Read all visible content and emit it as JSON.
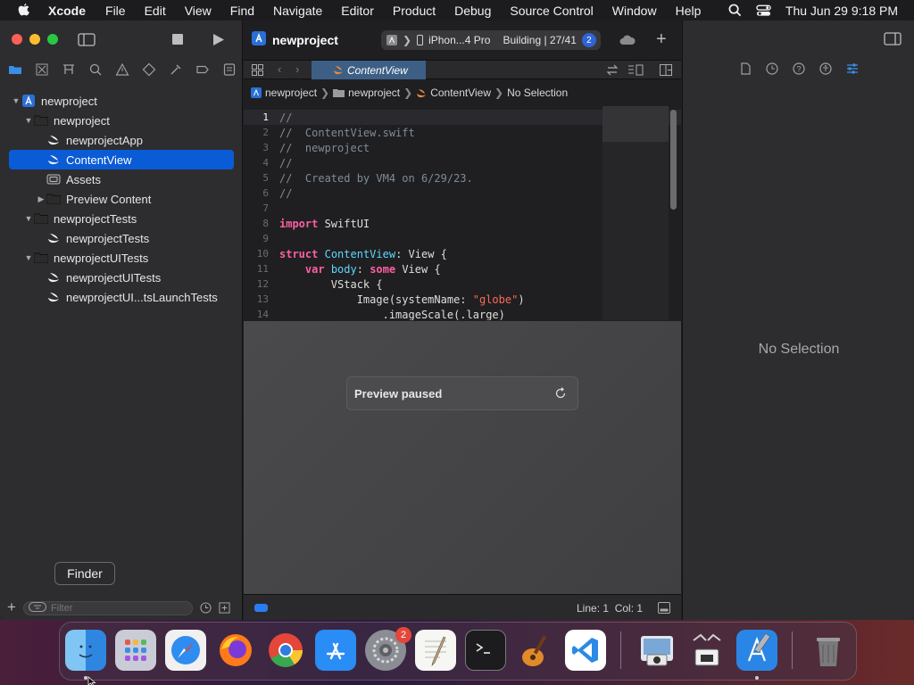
{
  "menubar": {
    "app": "Xcode",
    "items": [
      "File",
      "Edit",
      "View",
      "Find",
      "Navigate",
      "Editor",
      "Product",
      "Debug",
      "Source Control",
      "Window",
      "Help"
    ],
    "datetime": "Thu Jun 29  9:18 PM"
  },
  "toolbar": {
    "project": "newproject",
    "device": "iPhon...4 Pro",
    "status": "Building | 27/41",
    "badge": "2"
  },
  "navigator": {
    "tree": [
      {
        "label": "newproject",
        "level": 0,
        "disclosure": "open",
        "icon": "xcodeproj-icon"
      },
      {
        "label": "newproject",
        "level": 1,
        "disclosure": "open",
        "icon": "folder-icon"
      },
      {
        "label": "newprojectApp",
        "level": 2,
        "disclosure": "",
        "icon": "swift-file-icon"
      },
      {
        "label": "ContentView",
        "level": 2,
        "disclosure": "",
        "icon": "swift-file-icon",
        "selected": true
      },
      {
        "label": "Assets",
        "level": 2,
        "disclosure": "",
        "icon": "assets-icon"
      },
      {
        "label": "Preview Content",
        "level": 2,
        "disclosure": "closed",
        "icon": "folder-icon"
      },
      {
        "label": "newprojectTests",
        "level": 1,
        "disclosure": "open",
        "icon": "folder-icon"
      },
      {
        "label": "newprojectTests",
        "level": 2,
        "disclosure": "",
        "icon": "swift-file-icon"
      },
      {
        "label": "newprojectUITests",
        "level": 1,
        "disclosure": "open",
        "icon": "folder-icon"
      },
      {
        "label": "newprojectUITests",
        "level": 2,
        "disclosure": "",
        "icon": "swift-file-icon"
      },
      {
        "label": "newprojectUI...tsLaunchTests",
        "level": 2,
        "disclosure": "",
        "icon": "swift-file-icon"
      }
    ],
    "filter_placeholder": "Filter"
  },
  "tooltip": "Finder",
  "editor": {
    "tab": "ContentView",
    "breadcrumb": [
      "newproject",
      "newproject",
      "ContentView",
      "No Selection"
    ],
    "code": [
      [
        {
          "t": "//",
          "c": "com"
        }
      ],
      [
        {
          "t": "//  ContentView.swift",
          "c": "com"
        }
      ],
      [
        {
          "t": "//  newproject",
          "c": "com"
        }
      ],
      [
        {
          "t": "//",
          "c": "com"
        }
      ],
      [
        {
          "t": "//  Created by VM4 on 6/29/23.",
          "c": "com"
        }
      ],
      [
        {
          "t": "//",
          "c": "com"
        }
      ],
      [],
      [
        {
          "t": "import",
          "c": "kw"
        },
        {
          "t": " SwiftUI",
          "c": ""
        }
      ],
      [],
      [
        {
          "t": "struct",
          "c": "kw"
        },
        {
          "t": " ",
          "c": ""
        },
        {
          "t": "ContentView",
          "c": "type"
        },
        {
          "t": ": View {",
          "c": ""
        }
      ],
      [
        {
          "t": "    ",
          "c": ""
        },
        {
          "t": "var",
          "c": "kw"
        },
        {
          "t": " ",
          "c": ""
        },
        {
          "t": "body",
          "c": "type"
        },
        {
          "t": ": ",
          "c": ""
        },
        {
          "t": "some",
          "c": "kw"
        },
        {
          "t": " View {",
          "c": ""
        }
      ],
      [
        {
          "t": "        VStack {",
          "c": ""
        }
      ],
      [
        {
          "t": "            Image(systemName: ",
          "c": ""
        },
        {
          "t": "\"globe\"",
          "c": "str"
        },
        {
          "t": ")",
          "c": ""
        }
      ],
      [
        {
          "t": "                .imageScale(.large)",
          "c": ""
        }
      ]
    ],
    "preview_status": "Preview paused",
    "cursor": "Line: 1  Col: 1"
  },
  "inspector": {
    "empty_label": "No Selection"
  },
  "dock": {
    "apps": [
      "finder",
      "launchpad",
      "safari",
      "firefox",
      "chrome",
      "app-store",
      "system-settings",
      "textedit",
      "terminal",
      "garageband",
      "vscode",
      "preview",
      "system-information",
      "xcode",
      "trash"
    ],
    "settings_badge": "2"
  }
}
